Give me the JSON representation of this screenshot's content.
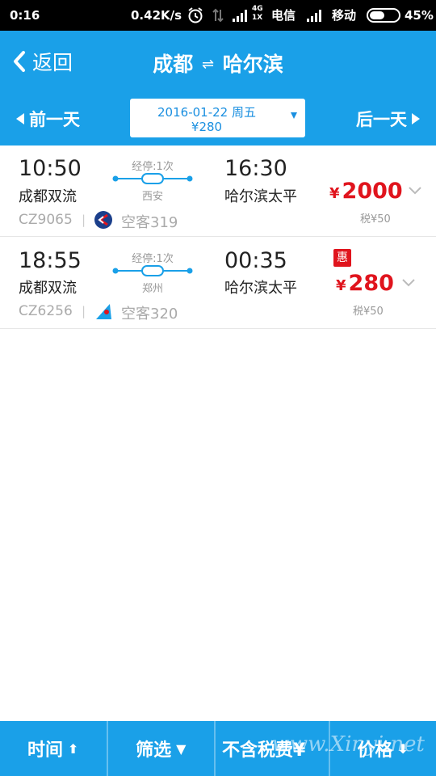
{
  "status_bar": {
    "time": "0:16",
    "speed": "0.42K/s",
    "carrier1": "电信",
    "carrier2": "移动",
    "net_top": "4G",
    "net_bottom": "1X",
    "battery": "45%"
  },
  "header": {
    "back_label": "返回",
    "origin": "成都",
    "swap_symbol": "⇌",
    "destination": "哈尔滨"
  },
  "day_nav": {
    "prev_label": "前一天",
    "next_label": "后一天",
    "date": "2016-01-22  周五",
    "lowest_price": "¥280"
  },
  "flights": [
    {
      "dep_time": "10:50",
      "dep_airport": "成都双流",
      "stop_label": "经停:1次",
      "stop_city": "西安",
      "arr_time": "16:30",
      "arr_airport": "哈尔滨太平",
      "flight_no": "CZ9065",
      "separator": "|",
      "aircraft": "空客319",
      "currency": "¥",
      "price": "2000",
      "tax": "税¥50",
      "airline_icon": "china-eastern-logo",
      "badge": ""
    },
    {
      "dep_time": "18:55",
      "dep_airport": "成都双流",
      "stop_label": "经停:1次",
      "stop_city": "郑州",
      "arr_time": "00:35",
      "arr_airport": "哈尔滨太平",
      "flight_no": "CZ6256",
      "separator": "|",
      "aircraft": "空客320",
      "currency": "¥",
      "price": "280",
      "tax": "税¥50",
      "airline_icon": "china-southern-logo",
      "badge": "惠"
    }
  ],
  "tab_bar": {
    "time_label": "时间",
    "filter_label": "筛选",
    "tax_label": "不含税费¥",
    "price_label": "价格"
  },
  "watermark": "www.Xinyi.net",
  "colors": {
    "brand_blue": "#1aa0e8",
    "price_red": "#e0141d"
  }
}
